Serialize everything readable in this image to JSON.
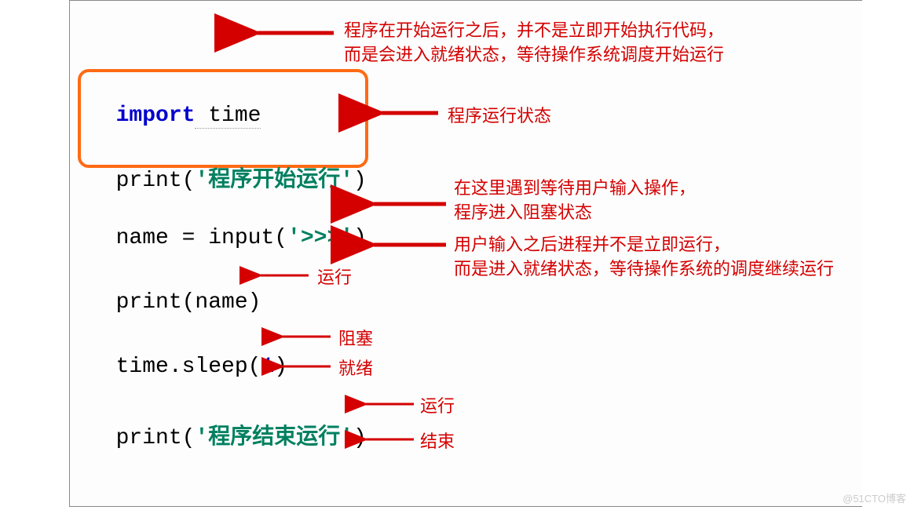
{
  "code": {
    "line1_import": "import",
    "line1_time": " time",
    "line2_prefix": "print(",
    "line2_str": "'程序开始运行'",
    "line2_suffix": ")",
    "line3": "name = input(",
    "line3_str": "'>>>'",
    "line3_suffix": ")",
    "line4": "print(name)",
    "line5": "time.sleep(",
    "line5_num": "1",
    "line5_suffix": ")",
    "line6_prefix": "print(",
    "line6_str": "'程序结束运行'",
    "line6_suffix": ")"
  },
  "annotations": {
    "top_line1": "程序在开始运行之后，并不是立即开始执行代码，",
    "top_line2": "而是会进入就绪状态，等待操作系统调度开始运行",
    "status": "程序运行状态",
    "input_line1": "在这里遇到等待用户输入操作，",
    "input_line2": "程序进入阻塞状态",
    "after_input_line1": "用户输入之后进程并不是立即运行，",
    "after_input_line2": "而是进入就绪状态，等待操作系统的调度继续运行",
    "run": "运行",
    "block": "阻塞",
    "ready": "就绪",
    "run2": "运行",
    "end": "结束"
  },
  "watermark": "@51CTO博客"
}
